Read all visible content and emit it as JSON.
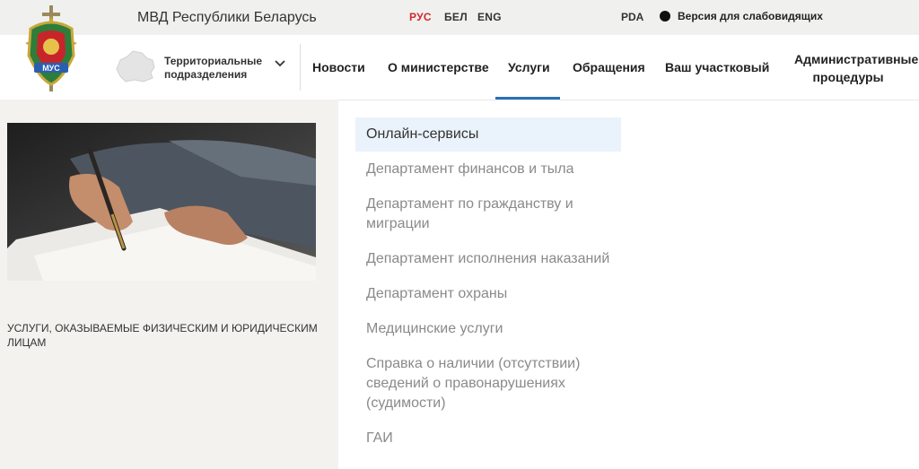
{
  "topbar": {
    "site_title": "МВД Республики Беларусь",
    "languages": [
      {
        "label": "РУС",
        "active": true
      },
      {
        "label": "БЕЛ",
        "active": false
      },
      {
        "label": "ENG",
        "active": false
      }
    ],
    "pda_label": "PDA",
    "vision_label": "Версия для слабовидящих"
  },
  "emblem": {
    "text": "МУС"
  },
  "nav": {
    "territorial_line1": "Территориальные",
    "territorial_line2": "подразделения",
    "items": [
      {
        "label": "Новости"
      },
      {
        "label": "О министерстве"
      },
      {
        "label": "Услуги",
        "active": true
      },
      {
        "label": "Обращения"
      },
      {
        "label": "Ваш участковый"
      },
      {
        "label": "Административные процедуры"
      }
    ]
  },
  "left_panel": {
    "caption": "УСЛУГИ, ОКАЗЫВАЕМЫЕ ФИЗИЧЕСКИМ И ЮРИДИЧЕСКИМ ЛИЦАМ"
  },
  "menu": {
    "items": [
      {
        "label": "Онлайн-сервисы",
        "active": true
      },
      {
        "label": "Департамент финансов и тыла"
      },
      {
        "label": "Департамент по гражданству и миграции"
      },
      {
        "label": "Департамент исполнения наказаний"
      },
      {
        "label": "Департамент охраны"
      },
      {
        "label": "Медицинские услуги"
      },
      {
        "label": "Справка о наличии (отсутствии) сведений о правонарушениях (судимости)"
      },
      {
        "label": "ГАИ"
      }
    ]
  },
  "colors": {
    "accent_red": "#d0282e",
    "accent_blue": "#2a6fb5",
    "topbar_bg": "#f0f0ee",
    "menu_active_bg": "#eaf3fb"
  }
}
